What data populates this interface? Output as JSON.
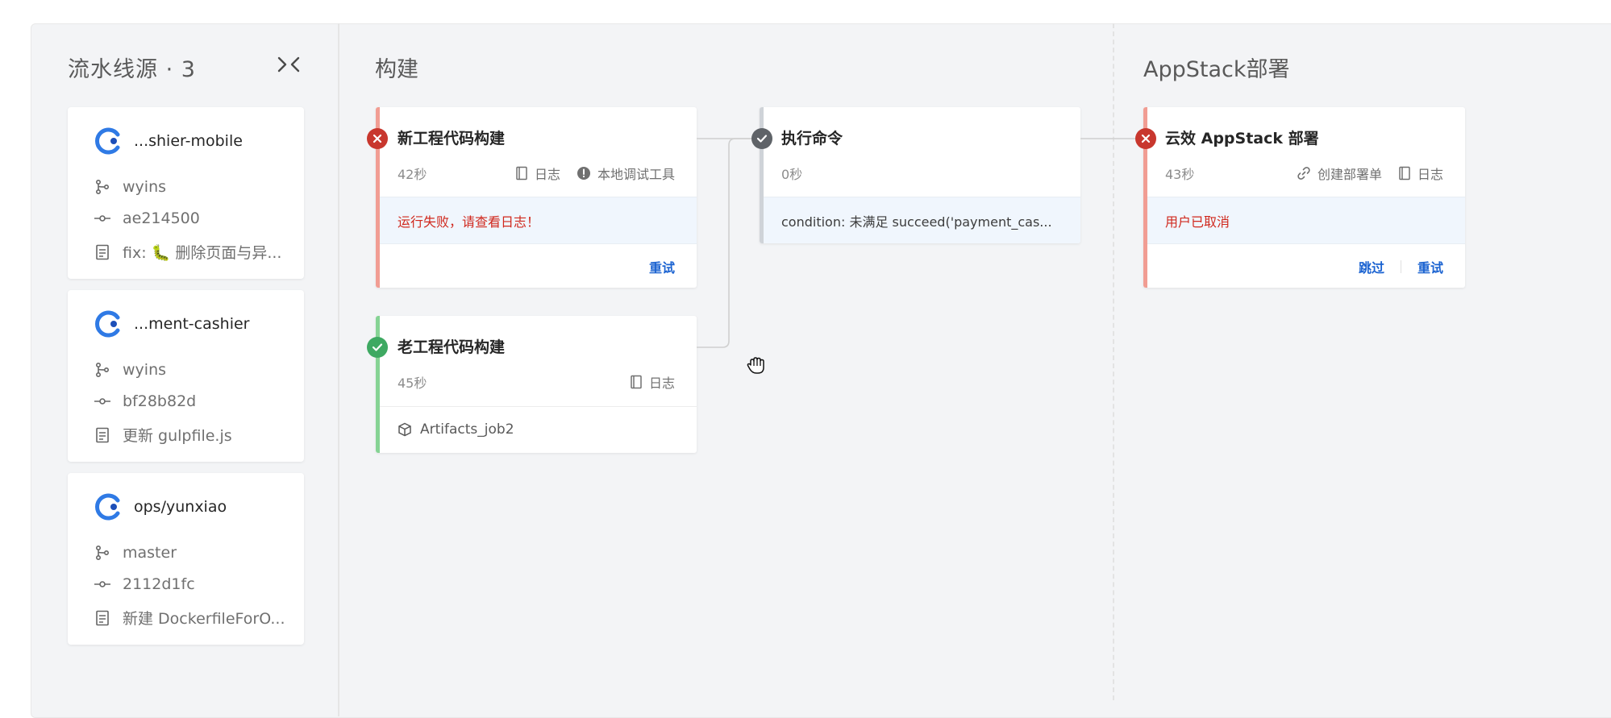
{
  "sources": {
    "title": "流水线源 · 3",
    "items": [
      {
        "repo": "...shier-mobile",
        "branch": "wyins",
        "commit": "ae214500",
        "message": "fix: 🐛 删除页面与异..."
      },
      {
        "repo": "...ment-cashier",
        "branch": "wyins",
        "commit": "bf28b82d",
        "message": "更新 gulpfile.js"
      },
      {
        "repo": "ops/yunxiao",
        "branch": "master",
        "commit": "2112d1fc",
        "message": "新建 DockerfileForO..."
      }
    ]
  },
  "stages": {
    "build": {
      "title": "构建",
      "jobs": {
        "new_build": {
          "title": "新工程代码构建",
          "duration": "42秒",
          "log_label": "日志",
          "debug_label": "本地调试工具",
          "message": "运行失败，请查看日志！",
          "retry_label": "重试"
        },
        "old_build": {
          "title": "老工程代码构建",
          "duration": "45秒",
          "log_label": "日志",
          "artifact": "Artifacts_job2"
        },
        "exec_cmd": {
          "title": "执行命令",
          "duration": "0秒",
          "message": "condition: 未满足 succeed('payment_cas..."
        }
      }
    },
    "deploy": {
      "title": "AppStack部署",
      "jobs": {
        "appstack": {
          "title": "云效 AppStack 部署",
          "duration": "43秒",
          "create_label": "创建部署单",
          "log_label": "日志",
          "message": "用户已取消",
          "skip_label": "跳过",
          "retry_label": "重试"
        }
      }
    }
  },
  "colors": {
    "fail": "#c8372e",
    "success": "#3ea962",
    "skipped": "#5f6368",
    "link": "#1b63d1",
    "error_text": "#d0281d"
  },
  "icons": {
    "collapse": "collapse-chevrons-icon",
    "branch": "git-branch-icon",
    "commit": "git-commit-icon",
    "message": "document-icon",
    "log": "book-icon",
    "debug": "exclamation-circle-icon",
    "link": "link-icon",
    "artifact": "package-icon",
    "cursor": "hand-grab-icon"
  }
}
